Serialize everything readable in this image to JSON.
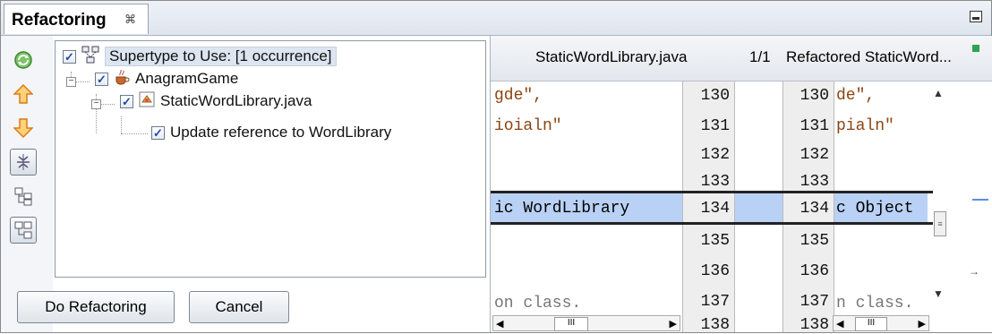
{
  "panel": {
    "tab_title": "Refactoring",
    "tab_close": "⌘"
  },
  "toolbar": {
    "buttons": [
      "refresh-icon",
      "arrow-up-icon",
      "arrow-down-icon",
      "expand-collapse-icon",
      "logical-view-icon",
      "physical-view-icon"
    ]
  },
  "tree": {
    "root": {
      "label": "Supertype to Use: [1 occurrence]",
      "checked": true
    },
    "project": {
      "label": "AnagramGame",
      "checked": true
    },
    "file": {
      "label": "StaticWordLibrary.java",
      "checked": true
    },
    "change": {
      "label": "Update reference to WordLibrary",
      "checked": true
    }
  },
  "buttons": {
    "do_refactoring": "Do Refactoring",
    "cancel": "Cancel"
  },
  "diff": {
    "left_title": "StaticWordLibrary.java",
    "counter": "1/1",
    "right_title": "Refactored StaticWord...",
    "left_code": [
      "gde\",",
      "ioialn\"",
      "",
      "",
      "ic WordLibrary",
      "",
      "",
      "on class."
    ],
    "right_code": [
      "de\",",
      "pialn\"",
      "",
      "",
      "c Object",
      "",
      "",
      "n class."
    ],
    "line_numbers": [
      "130",
      "131",
      "132",
      "133",
      "134",
      "135",
      "136",
      "137",
      "138"
    ],
    "highlight_color": "#b9d1f5",
    "scroll_thumb": "III"
  }
}
